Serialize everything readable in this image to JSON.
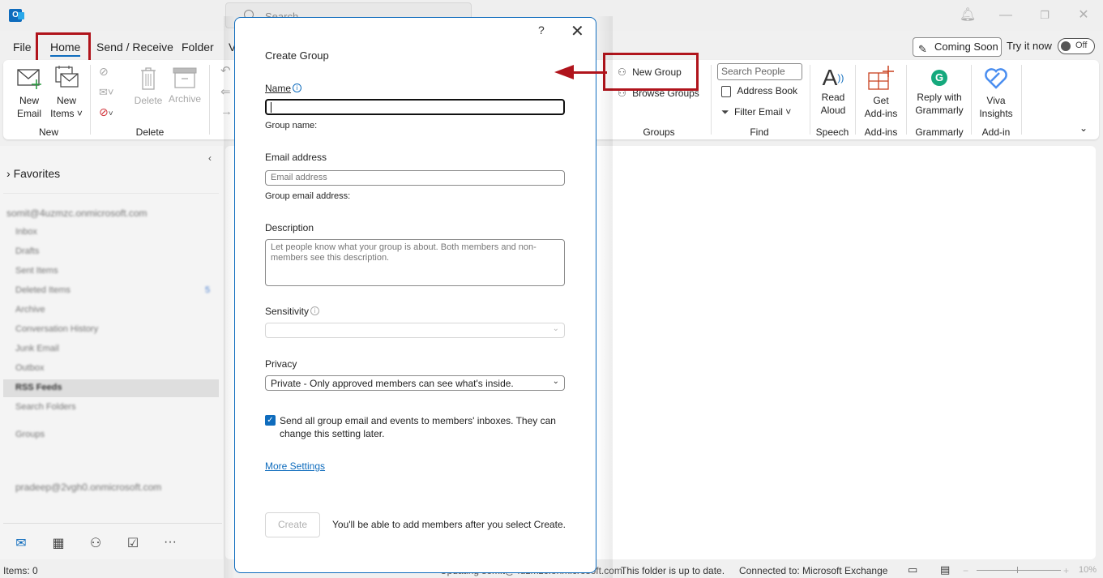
{
  "titlebar": {
    "app_icon": "outlook-icon",
    "search_placeholder": "Search",
    "window_controls": [
      "notification-bell",
      "minimize",
      "restore",
      "close"
    ]
  },
  "tabs": [
    {
      "label": "File"
    },
    {
      "label": "Home",
      "active": true
    },
    {
      "label": "Send / Receive"
    },
    {
      "label": "Folder"
    },
    {
      "label": "V"
    }
  ],
  "top_right": {
    "coming_soon_label": "Coming Soon",
    "try_it_now_label": "Try it now",
    "toggle_state_label": "Off"
  },
  "ribbon": {
    "new_group": {
      "label": "New",
      "new_email": [
        "New",
        "Email"
      ],
      "new_items": [
        "New",
        "Items ˅"
      ]
    },
    "delete_group": {
      "label": "Delete",
      "delete": "Delete",
      "archive": "Archive"
    },
    "groups_group": {
      "label": "Groups",
      "new_group": "New Group",
      "browse_groups": "Browse Groups"
    },
    "find_group": {
      "label": "Find",
      "search_people_placeholder": "Search People",
      "address_book": "Address Book",
      "filter_email": "Filter Email ˅"
    },
    "speech_group": {
      "label": "Speech",
      "read_aloud": [
        "Read",
        "Aloud"
      ]
    },
    "addins_group": {
      "label": "Add-ins",
      "get_addins": [
        "Get",
        "Add-ins"
      ]
    },
    "grammarly_group": {
      "label": "Grammarly",
      "reply": [
        "Reply with",
        "Grammarly"
      ]
    },
    "addin_group": {
      "label": "Add-in",
      "viva": [
        "Viva",
        "Insights"
      ]
    }
  },
  "sidebar": {
    "favorites_label": "Favorites",
    "account1": "somit@4uzmzc.onmicrosoft.com",
    "folders": [
      "Inbox",
      "Drafts",
      "Sent Items",
      "Deleted Items",
      "Archive",
      "Conversation History",
      "Junk Email",
      "Outbox",
      "RSS Feeds",
      "Search Folders"
    ],
    "deleted_count": "5",
    "groups_label": "Groups",
    "account2": "pradeep@2vgh0.onmicrosoft.com",
    "selected_folder": "RSS Feeds"
  },
  "nav": [
    "mail",
    "calendar",
    "people",
    "tasks",
    "more"
  ],
  "statusbar": {
    "items": "Items: 0",
    "updating": "Updating somit@4uzmzc.onmicrosoft.com.",
    "folder_status": "This folder is up to date.",
    "connection": "Connected to: Microsoft Exchange",
    "zoom": "10%"
  },
  "dialog": {
    "help": "?",
    "title": "Create Group",
    "name_label": "Name",
    "name_value": "",
    "group_name_hint": "Group name:",
    "email_label": "Email address",
    "email_placeholder": "Email address",
    "group_email_hint": "Group email address:",
    "description_label": "Description",
    "description_placeholder": "Let people know what your group is about. Both members and non-members see this description.",
    "sensitivity_label": "Sensitivity",
    "sensitivity_value": "",
    "privacy_label": "Privacy",
    "privacy_value": "Private - Only approved members can see what's inside.",
    "send_all_checked": true,
    "send_all_label": "Send all group email and events to members' inboxes. They can change this setting later.",
    "more_settings": "More Settings",
    "create_button": "Create",
    "create_hint": "You'll be able to add members after you select Create."
  },
  "colors": {
    "accent": "#0f6cbd",
    "annotation_red": "#b0141c"
  }
}
